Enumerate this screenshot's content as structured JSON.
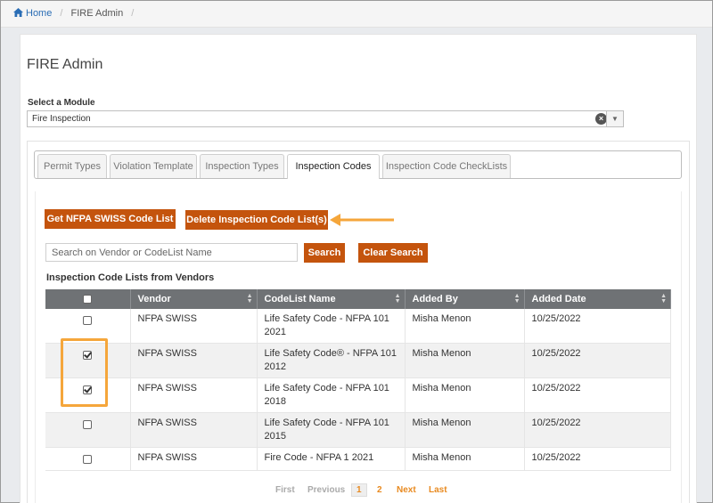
{
  "breadcrumb": {
    "home": "Home",
    "current": "FIRE Admin"
  },
  "page": {
    "title": "FIRE Admin"
  },
  "module": {
    "label": "Select a Module",
    "selected": "Fire Inspection"
  },
  "tabs": [
    {
      "label": "Permit Types",
      "active": false
    },
    {
      "label": "Violation Template",
      "active": false
    },
    {
      "label": "Inspection Types",
      "active": false
    },
    {
      "label": "Inspection Codes",
      "active": true
    },
    {
      "label": "Inspection Code CheckLists",
      "active": false
    }
  ],
  "actions": {
    "get_codes": "Get NFPA SWISS Code List",
    "delete_codes": "Delete Inspection Code List(s)",
    "search": "Search",
    "clear_search": "Clear Search"
  },
  "search": {
    "placeholder": "Search on Vendor or CodeList Name",
    "value": ""
  },
  "table": {
    "title": "Inspection Code Lists from Vendors",
    "columns": [
      "Vendor",
      "CodeList Name",
      "Added By",
      "Added Date"
    ],
    "rows": [
      {
        "checked": false,
        "vendor": "NFPA SWISS",
        "name_line1": "Life Safety Code - NFPA 101",
        "name_line2": "2021",
        "added_by": "Misha Menon",
        "added_date": "10/25/2022"
      },
      {
        "checked": true,
        "vendor": "NFPA SWISS",
        "name_line1": "Life Safety Code® - NFPA 101",
        "name_line2": "2012",
        "added_by": "Misha Menon",
        "added_date": "10/25/2022"
      },
      {
        "checked": true,
        "vendor": "NFPA SWISS",
        "name_line1": "Life Safety Code - NFPA 101",
        "name_line2": "2018",
        "added_by": "Misha Menon",
        "added_date": "10/25/2022"
      },
      {
        "checked": false,
        "vendor": "NFPA SWISS",
        "name_line1": "Life Safety Code - NFPA 101",
        "name_line2": "2015",
        "added_by": "Misha Menon",
        "added_date": "10/25/2022"
      },
      {
        "checked": false,
        "vendor": "NFPA SWISS",
        "name_line1": "Fire Code - NFPA 1 2021",
        "name_line2": "",
        "added_by": "Misha Menon",
        "added_date": "10/25/2022"
      }
    ]
  },
  "pager": {
    "first": "First",
    "previous": "Previous",
    "pages": [
      "1",
      "2"
    ],
    "current": "1",
    "next": "Next",
    "last": "Last"
  },
  "colors": {
    "accent": "#c4540d",
    "header": "#6f7275",
    "highlight": "#f5a63b",
    "link": "#2a6db5"
  }
}
